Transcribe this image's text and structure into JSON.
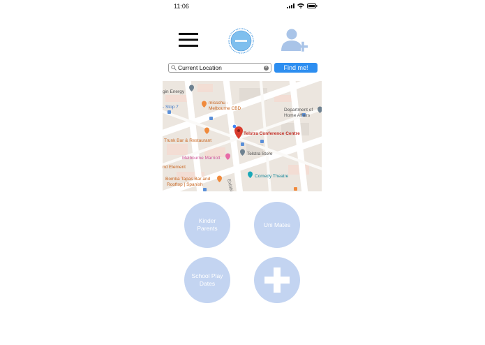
{
  "status_bar": {
    "time": "11:06"
  },
  "search": {
    "value": "Current Location",
    "button_label": "Find me!"
  },
  "map": {
    "labels": {
      "origin_energy": "gin Energy",
      "stop7": "- Stop 7",
      "misschu": "misschu -",
      "misschu2": "Melbourne CBD",
      "dept": "Department of",
      "dept2": "Home Affairs",
      "trunk": "Trunk Bar & Restaurant",
      "telstra_cc": "Telstra Conference Centre",
      "telstra_store": "Telstra Store",
      "marriott": "Melbourne Marriott",
      "element": "nd Element",
      "exhibition": "Exhibition",
      "bomba": "Bomba Tapas Bar and",
      "bomba2": "Rooftop | Spanish",
      "comedy": "Comedy Theatre"
    },
    "colors": {
      "road": "#ffffff",
      "block": "#f3efe9",
      "poi_orange": "#f08a3c",
      "poi_grey": "#6e8190",
      "poi_pink": "#e76aa7",
      "poi_teal": "#19a8b8",
      "pin": "#d93b2d",
      "label_red": "#c4322a"
    }
  },
  "groups": [
    {
      "label": "Kinder\nParents"
    },
    {
      "label": "Uni Mates"
    },
    {
      "label": "School Play\nDates"
    }
  ],
  "accent": "#2d8ef0",
  "circle_color": "#c3d4f1"
}
